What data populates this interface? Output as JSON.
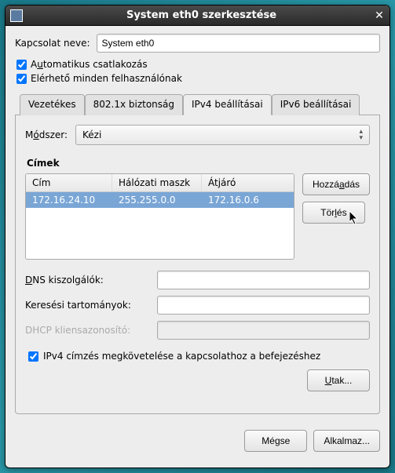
{
  "titlebar": {
    "title": "System eth0 szerkesztése"
  },
  "connection": {
    "name_label": "Kapcsolat neve:",
    "name_value": "System eth0",
    "auto_label_pre": "A",
    "auto_label_u": "u",
    "auto_label_post": "tomatikus csatlakozás",
    "avail_label": "Elérhető minden felhasználónak"
  },
  "tabs": {
    "wired": "Vezetékes",
    "security": "802.1x biztonság",
    "ipv4": "IPv4 beállításai",
    "ipv6": "IPv6 beállításai"
  },
  "ipv4": {
    "method_label_pre": "M",
    "method_label_u": "ó",
    "method_label_post": "dszer:",
    "method_value": "Kézi",
    "addresses_label": "Címek",
    "col_addr": "Cím",
    "col_mask": "Hálózati maszk",
    "col_gw": "Átjáró",
    "row": {
      "addr": "172.16.24.10",
      "mask": "255.255.0.0",
      "gw": "172.16.0.6"
    },
    "btn_add_pre": "Hozzá",
    "btn_add_u": "a",
    "btn_add_post": "dás",
    "btn_del_pre": "Tör",
    "btn_del_u": "l",
    "btn_del_post": "és",
    "dns_label_u": "D",
    "dns_label_post": "NS kiszolgálók:",
    "search_label": "Keresési tartományok:",
    "dhcp_label": "DHCP kliensazonosító:",
    "require_label": "IPv4 címzés megkövetelése a kapcsolathoz a befejezéshez",
    "routes_btn_u": "U",
    "routes_btn_post": "tak..."
  },
  "footer": {
    "cancel": "Mégse",
    "apply": "Alkalmaz..."
  }
}
